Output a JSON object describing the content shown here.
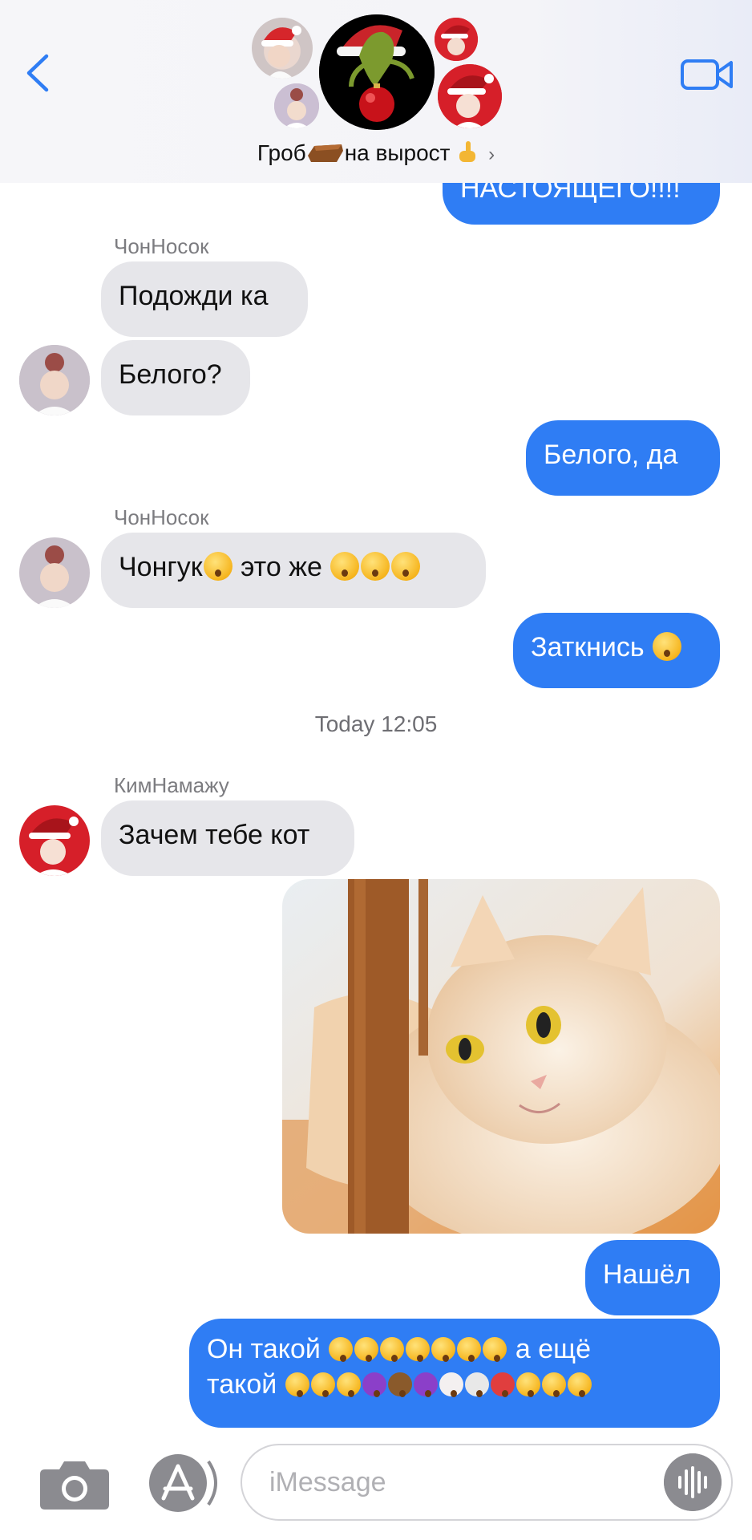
{
  "header": {
    "group_name": "Гроб",
    "group_name_rest": "на вырост",
    "back_icon": "chevron-left-icon",
    "video_icon": "video-camera-icon",
    "accent": "#2f7df4"
  },
  "messages": {
    "m0": {
      "text": "НАСТОЯЩЕГО!!!!",
      "dir": "out"
    },
    "s1": "ЧонНосок",
    "m1": {
      "text": "Подожди ка",
      "dir": "in"
    },
    "m2": {
      "text": "Белого?",
      "dir": "in"
    },
    "m3": {
      "text": "Белого,  да",
      "dir": "out"
    },
    "s4": "ЧонНосок",
    "m4": {
      "text": "Чонгук",
      "text2": "это же",
      "dir": "in"
    },
    "m5": {
      "text": "Заткнись",
      "dir": "out"
    },
    "timestamp": "Today 12:05",
    "s6": "КимНамажу",
    "m6": {
      "text": "Зачем тебе кот",
      "dir": "in"
    },
    "m7": {
      "type": "image",
      "description_icon": "cat-photo"
    },
    "m8": {
      "text": "Нашёл",
      "dir": "out"
    },
    "m9": {
      "line1": "Он такой",
      "line1_end": "а ещё",
      "line2": "такой",
      "dir": "out"
    }
  },
  "input": {
    "placeholder": "iMessage",
    "camera_icon": "camera-icon",
    "apps_icon": "app-store-icon",
    "audio_icon": "audio-waveform-icon"
  },
  "colors": {
    "outgoing_bubble": "#2f7df4",
    "incoming_bubble": "#e6e6ea"
  }
}
